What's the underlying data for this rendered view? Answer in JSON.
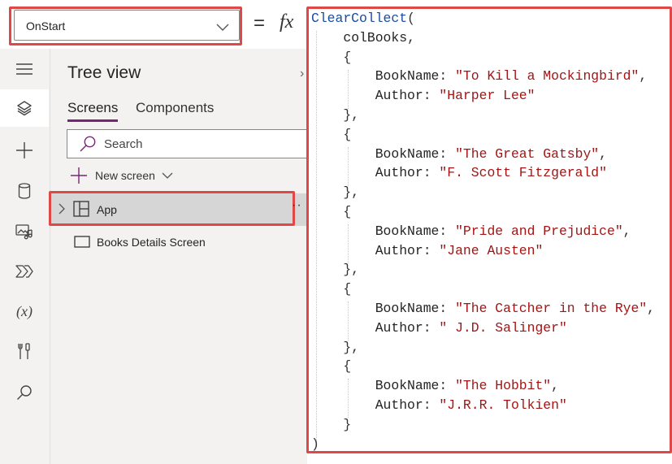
{
  "property_bar": {
    "selected_property": "OnStart",
    "equals": "=",
    "fx": "fx"
  },
  "rail": {
    "items": [
      "hamburger-menu",
      "tree-view-layers",
      "insert-plus",
      "data-cylinder",
      "media",
      "power-automate",
      "variables",
      "advanced-tools",
      "search"
    ],
    "variables_glyph": "(x)",
    "active_item": "tree-view-layers"
  },
  "tree_view": {
    "title": "Tree view",
    "close_glyph": "›",
    "tabs": [
      {
        "label": "Screens",
        "selected": true
      },
      {
        "label": "Components",
        "selected": false
      }
    ],
    "search_placeholder": "Search",
    "new_screen_label": "New screen",
    "nodes": [
      {
        "label": "App",
        "type": "app",
        "selected": true,
        "expandable": true
      },
      {
        "label": "Books Details Screen",
        "type": "screen",
        "selected": false,
        "expandable": false
      }
    ],
    "more_glyph": "··"
  },
  "formula": {
    "function": "ClearCollect",
    "collection": "colBooks",
    "records": [
      {
        "BookName": "To Kill a Mockingbird",
        "Author": "Harper Lee"
      },
      {
        "BookName": "The Great Gatsby",
        "Author": "F. Scott Fitzgerald"
      },
      {
        "BookName": "Pride and Prejudice",
        "Author": "Jane Austen"
      },
      {
        "BookName": "The Catcher in the Rye",
        "Author": " J.D. Salinger"
      },
      {
        "BookName": "The Hobbit",
        "Author": "J.R.R. Tolkien"
      }
    ]
  },
  "colors": {
    "highlight_border": "#e04848",
    "function_blue": "#1a4ca1",
    "string_red": "#a31515",
    "tab_accent": "#742774",
    "selected_row": "#d6d6d6",
    "pane_background": "#f3f2f1"
  }
}
